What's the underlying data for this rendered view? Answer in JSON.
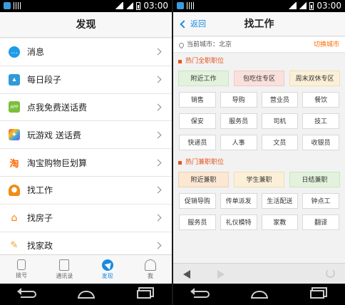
{
  "status": {
    "time": "03:00"
  },
  "left": {
    "title": "发现",
    "menu": [
      {
        "label": "消息",
        "icon": "message-icon",
        "color": "#1e9be9"
      },
      {
        "label": "每日段子",
        "icon": "picture-icon",
        "color": "#2f9ad8"
      },
      {
        "label": "点我免费送话费",
        "icon": "app-icon",
        "color": "#7bbf3a"
      },
      {
        "label": "玩游戏 送话费",
        "icon": "game-icon",
        "color": "#8a5ad8"
      },
      {
        "label": "淘宝购物巨划算",
        "icon": "taobao-icon",
        "color": "#ff6a00"
      },
      {
        "label": "找工作",
        "icon": "worker-icon",
        "color": "#f08c18"
      },
      {
        "label": "找房子",
        "icon": "house-icon",
        "color": "#ff7a00"
      },
      {
        "label": "找家政",
        "icon": "broom-icon",
        "color": "#f0a020"
      }
    ],
    "tabs": [
      {
        "label": "拨号",
        "icon": "phone-icon"
      },
      {
        "label": "通讯录",
        "icon": "contacts-icon"
      },
      {
        "label": "发现",
        "icon": "discover-icon"
      },
      {
        "label": "我",
        "icon": "me-icon"
      }
    ]
  },
  "right": {
    "back_label": "返回",
    "title": "找工作",
    "city_text": "当前城市：北京",
    "switch_city": "切换城市",
    "fulltime_title": "热门全职职位",
    "fulltime_hot": [
      "附近工作",
      "包吃住专区",
      "周末双休专区"
    ],
    "fulltime_jobs": [
      "销售",
      "导购",
      "营业员",
      "餐饮",
      "保安",
      "服务员",
      "司机",
      "技工",
      "快递员",
      "人事",
      "文员",
      "收银员"
    ],
    "parttime_title": "热门兼职职位",
    "parttime_hot": [
      "附近兼职",
      "学生兼职",
      "日结兼职"
    ],
    "parttime_jobs": [
      "促销导购",
      "传单派发",
      "生活配送",
      "钟点工",
      "服务员",
      "礼仪模特",
      "家教",
      "翻译"
    ]
  }
}
